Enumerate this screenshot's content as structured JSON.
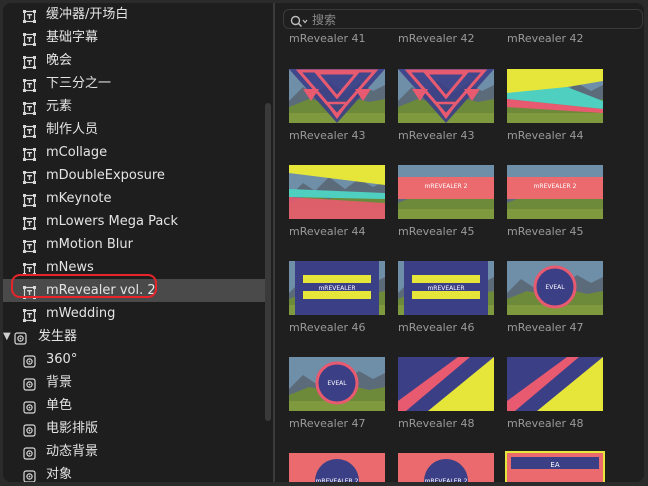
{
  "sidebar": {
    "items": [
      {
        "label": "缓冲器/开场白"
      },
      {
        "label": "基础字幕"
      },
      {
        "label": "晚会"
      },
      {
        "label": "下三分之一"
      },
      {
        "label": "元素"
      },
      {
        "label": "制作人员"
      },
      {
        "label": "mCollage"
      },
      {
        "label": "mDoubleExposure"
      },
      {
        "label": "mKeynote"
      },
      {
        "label": "mLowers Mega Pack"
      },
      {
        "label": "mMotion Blur"
      },
      {
        "label": "mNews"
      },
      {
        "label": "mRevealer vol. 2"
      },
      {
        "label": "mWedding"
      }
    ],
    "generators_label": "发生器",
    "generator_items": [
      {
        "label": "360°"
      },
      {
        "label": "背景"
      },
      {
        "label": "单色"
      },
      {
        "label": "电影排版"
      },
      {
        "label": "动态背景"
      },
      {
        "label": "对象"
      }
    ]
  },
  "search": {
    "placeholder": "搜索"
  },
  "browser": {
    "top_captions": [
      "mRevealer 41",
      "mRevealer 42",
      "mRevealer 42"
    ],
    "rows": [
      [
        "mRevealer 43",
        "mRevealer 43",
        "mRevealer 44"
      ],
      [
        "mRevealer 44",
        "mRevealer 45",
        "mRevealer 45"
      ],
      [
        "mRevealer 46",
        "mRevealer 46",
        "mRevealer 47"
      ],
      [
        "mRevealer 47",
        "mRevealer 48",
        "mRevealer 48"
      ]
    ],
    "thumb_text": {
      "title": "mREVEALER 2",
      "short": "mREVEALER",
      "abbr": "EVEAL",
      "tag": "EA"
    }
  }
}
